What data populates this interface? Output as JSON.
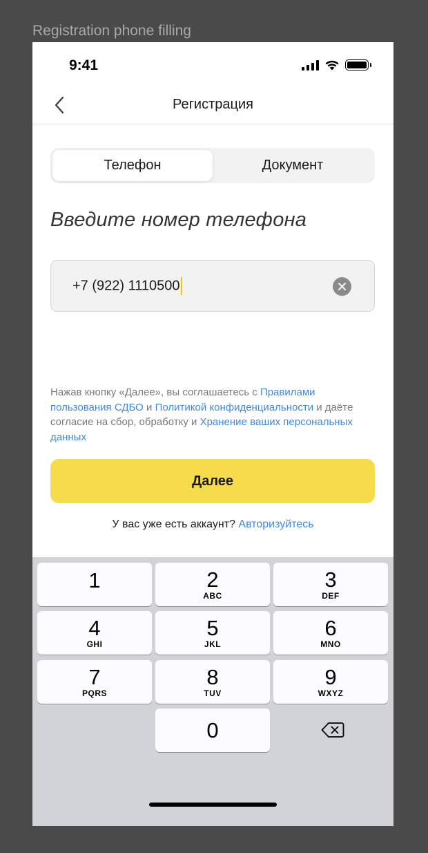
{
  "frame": {
    "label": "Registration phone filling"
  },
  "status_bar": {
    "time": "9:41",
    "icons": [
      "cellular-signal-icon",
      "wifi-icon",
      "battery-icon"
    ]
  },
  "nav": {
    "title": "Регистрация",
    "back_icon": "chevron-left-icon"
  },
  "tabs": [
    {
      "label": "Телефон",
      "active": true
    },
    {
      "label": "Документ",
      "active": false
    }
  ],
  "heading": "Введите номер телефона",
  "phone_input": {
    "value": "+7 (922) 1110500",
    "clear_icon": "clear-circle-icon"
  },
  "agreement": {
    "part1": "Нажав кнопку «Далее», вы соглашаетесь с ",
    "link1": "Правилами пользования СДБО",
    "part2": " и ",
    "link2": "Политикой конфиденциальности",
    "part3": " и даёте согласие на сбор, обработку и ",
    "link3": "Хранение ваших персональных данных"
  },
  "next_button": {
    "label": "Далее"
  },
  "login": {
    "text": "У вас уже есть аккаунт? ",
    "link": "Авторизуйтесь"
  },
  "keypad": {
    "keys": [
      {
        "num": "1",
        "letters": ""
      },
      {
        "num": "2",
        "letters": "ABC"
      },
      {
        "num": "3",
        "letters": "DEF"
      },
      {
        "num": "4",
        "letters": "GHI"
      },
      {
        "num": "5",
        "letters": "JKL"
      },
      {
        "num": "6",
        "letters": "MNO"
      },
      {
        "num": "7",
        "letters": "PQRS"
      },
      {
        "num": "8",
        "letters": "TUV"
      },
      {
        "num": "9",
        "letters": "WXYZ"
      },
      {
        "num": "0",
        "letters": ""
      }
    ],
    "delete_icon": "backspace-icon"
  },
  "colors": {
    "accent_yellow": "#f6dc4a",
    "link_blue": "#3f88e0",
    "caret": "#f5c400",
    "keyboard_bg": "#d1d3d9"
  }
}
